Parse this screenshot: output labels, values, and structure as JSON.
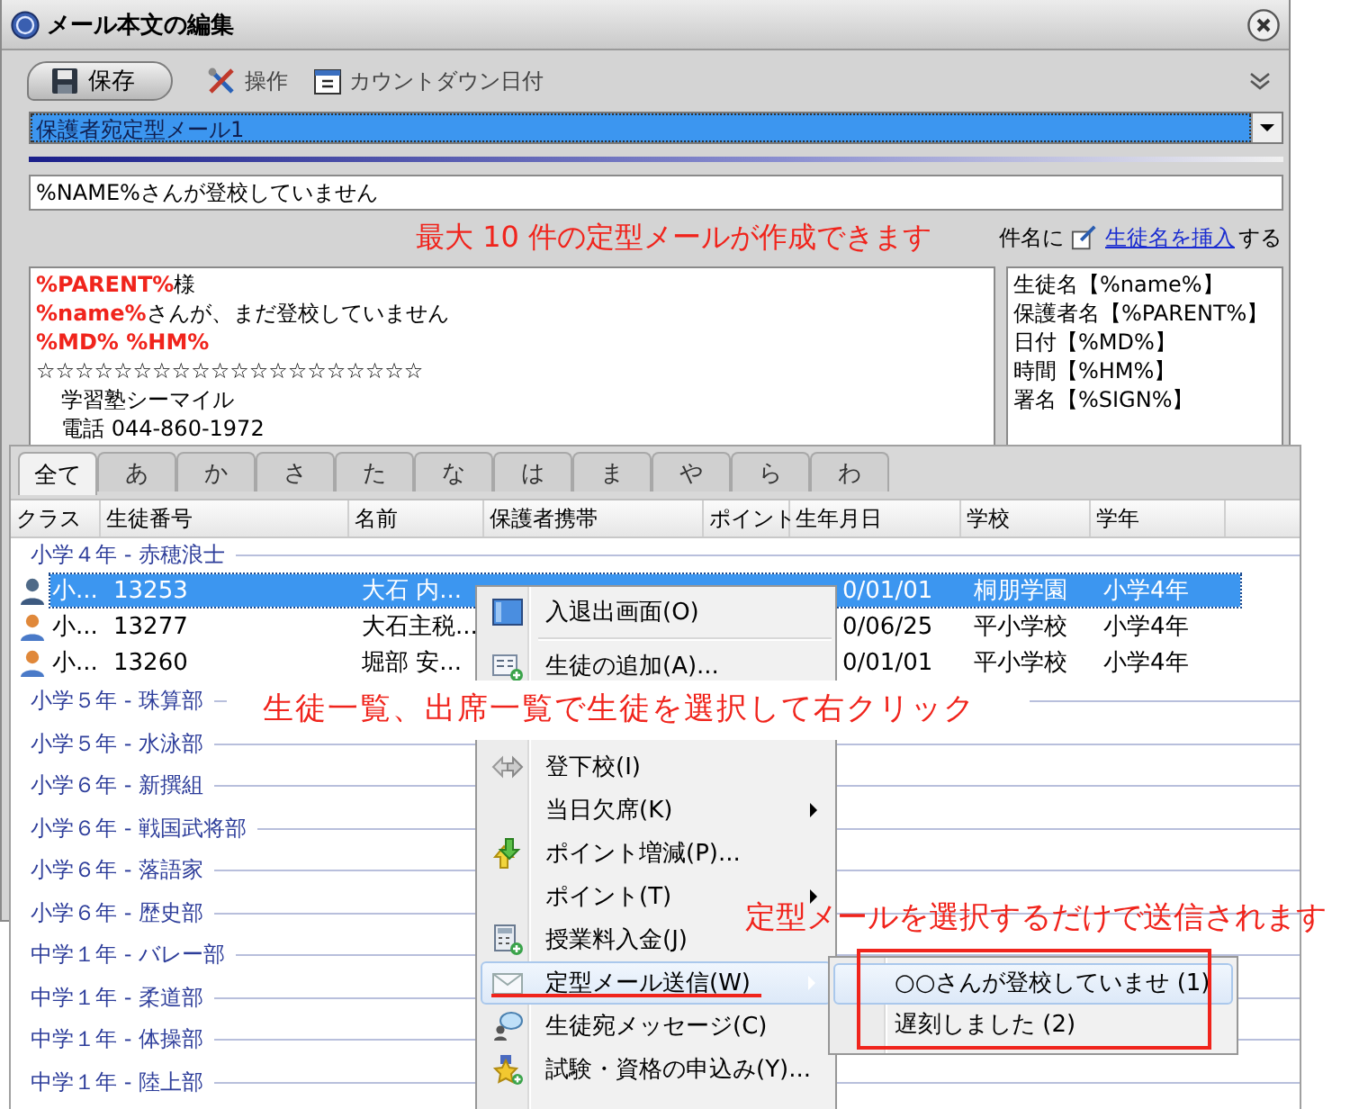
{
  "window": {
    "title": "メール本文の編集"
  },
  "toolbar": [
    {
      "label": "保存",
      "kind": "tab"
    },
    {
      "label": "操作",
      "kind": "tool"
    },
    {
      "label": "カウントダウン日付",
      "kind": "tool"
    }
  ],
  "template_select": {
    "value": "保護者宛定型メール1"
  },
  "subject": {
    "value": "%NAME%さんが登校していません"
  },
  "insert_hint": {
    "prefix": "件名に",
    "link": "生徒名を挿入",
    "suffix": "する"
  },
  "body_lines": [
    {
      "text": "**%PARENT%**様",
      "kind": "plain"
    },
    {
      "text": "**%name%**さんが、まだ登校していません",
      "kind": "plain"
    },
    {
      "text": "%MD%  %HM%",
      "kind": "tag"
    },
    {
      "text": "☆☆☆☆☆☆☆☆☆☆☆☆☆☆☆☆☆☆☆☆",
      "kind": "plain"
    },
    {
      "text": "学習塾シーマイル",
      "kind": "indented"
    },
    {
      "text": "電話 044-860-1972",
      "kind": "indented"
    }
  ],
  "variables": [
    "生徒名【%name%】",
    "保護者名【%PARENT%】",
    "日付【%MD%】",
    "時間【%HM%】",
    "署名【%SIGN%】"
  ],
  "list_tabs": [
    {
      "label": "全て",
      "selected": true
    },
    {
      "label": "あ",
      "selected": false
    },
    {
      "label": "か",
      "selected": false
    },
    {
      "label": "さ",
      "selected": false
    },
    {
      "label": "た",
      "selected": false
    },
    {
      "label": "な",
      "selected": false
    },
    {
      "label": "は",
      "selected": false
    },
    {
      "label": "ま",
      "selected": false
    },
    {
      "label": "や",
      "selected": false
    },
    {
      "label": "ら",
      "selected": false
    },
    {
      "label": "わ",
      "selected": false
    }
  ],
  "columns": [
    "クラス",
    "生徒番号",
    "名前",
    "保護者携帯",
    "ポイント",
    "生年月日",
    "学校",
    "学年"
  ],
  "groups": [
    {
      "title": "小学４年 - 赤穂浪士",
      "students": [
        {
          "class": "小...",
          "number": "13253",
          "name": "大石 内...",
          "birth": "0/01/01",
          "school": "桐朋学園",
          "grade": "小学4年",
          "selected": true
        },
        {
          "class": "小...",
          "number": "13277",
          "name": "大石主税...",
          "birth": "0/06/25",
          "school": "平小学校",
          "grade": "小学4年",
          "selected": false
        },
        {
          "class": "小...",
          "number": "13260",
          "name": "堀部 安...",
          "birth": "0/01/01",
          "school": "平小学校",
          "grade": "小学4年",
          "selected": false
        }
      ]
    },
    {
      "title": "小学５年 - 珠算部"
    },
    {
      "title": "小学５年 - 水泳部"
    },
    {
      "title": "小学６年 - 新撰組"
    },
    {
      "title": "小学６年 - 戦国武将部"
    },
    {
      "title": "小学６年 - 落語家"
    },
    {
      "title": "小学６年 - 歴史部"
    },
    {
      "title": "中学１年 - バレー部"
    },
    {
      "title": "中学１年 - 柔道部"
    },
    {
      "title": "中学１年 - 体操部"
    },
    {
      "title": "中学１年 - 陸上部"
    }
  ],
  "context_menu": [
    {
      "label": "入退出画面(O)",
      "has_submenu": false,
      "selected": false
    },
    {
      "label": "生徒の追加(A)...",
      "has_submenu": false,
      "selected": false
    },
    {
      "label": "登下校(I)",
      "has_submenu": false,
      "selected": false
    },
    {
      "label": "当日欠席(K)",
      "has_submenu": true,
      "selected": false
    },
    {
      "label": "ポイント増減(P)...",
      "has_submenu": false,
      "selected": false
    },
    {
      "label": "ポイント(T)",
      "has_submenu": true,
      "selected": false
    },
    {
      "label": "授業料入金(J)",
      "has_submenu": false,
      "selected": false
    },
    {
      "label": "定型メール送信(W)",
      "has_submenu": true,
      "selected": true
    },
    {
      "label": "生徒宛メッセージ(C)",
      "has_submenu": false,
      "selected": false
    },
    {
      "label": "試験・資格の申込み(Y)...",
      "has_submenu": false,
      "selected": false
    }
  ],
  "submenu": [
    {
      "label": "○○さんが登校していませ (1)",
      "selected": true
    },
    {
      "label": "遅刻しました (2)",
      "selected": false
    }
  ],
  "annotations": [
    "最大 10 件の定型メールが作成できます",
    "生徒一覧、出席一覧で生徒を選択して右クリック",
    "定型メールを選択するだけで送信されます"
  ]
}
